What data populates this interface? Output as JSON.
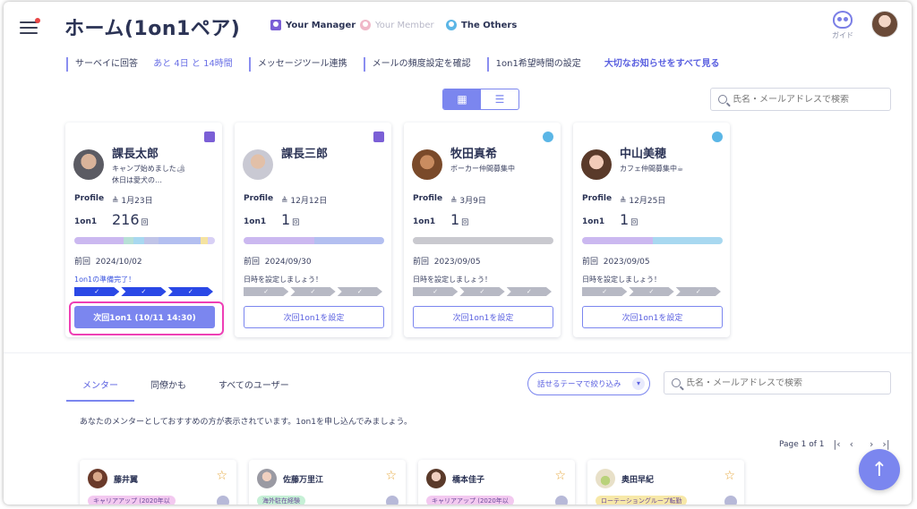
{
  "header": {
    "title": "ホーム(1on1ペア)",
    "legend": [
      {
        "label": "Your Manager",
        "icon": "manager-person-icon",
        "color": "#7b5fd6"
      },
      {
        "label": "Your Member",
        "icon": "member-person-icon",
        "color": "#f0b8c8"
      },
      {
        "label": "The Others",
        "icon": "others-person-icon",
        "color": "#5bb6e6"
      }
    ],
    "guide_label": "ガイド"
  },
  "linkbar": {
    "survey": "サーベイに回答",
    "survey_deadline": "あと 4日 と 14時間",
    "message_tool": "メッセージツール連携",
    "mail_frequency": "メールの頻度設定を確認",
    "preferred_time": "1on1希望時間の設定",
    "all_notices": "大切なお知らせをすべて見る"
  },
  "view_toggle": {
    "grid_icon": "grid-icon",
    "list_icon": "list-icon"
  },
  "search_top": {
    "placeholder": "氏名・メールアドレスで検索"
  },
  "pairs": [
    {
      "name": "課長太郎",
      "role": "manager",
      "status_line1": "キャンプ始めました🏕",
      "status_line2": "休日は愛犬の…",
      "profile_label": "Profile",
      "birthday": "1月23日",
      "oneonone_label": "1on1",
      "count": "216",
      "count_unit": "回",
      "bar": [
        {
          "color": "#cbb8f0",
          "w": 0.35
        },
        {
          "color": "#b7e0d6",
          "w": 0.07
        },
        {
          "color": "#a8d8f0",
          "w": 0.08
        },
        {
          "color": "#c0c4e8",
          "w": 0.1
        },
        {
          "color": "#b3bff0",
          "w": 0.3
        },
        {
          "color": "#f5e3a0",
          "w": 0.05
        },
        {
          "color": "#d8d0f5",
          "w": 0.05
        }
      ],
      "prev_label": "前回",
      "prev_date": "2024/10/02",
      "hint": "1on1の準備完了！",
      "steps_state": "done",
      "button": "次回1on1 (10/11 14:30)",
      "button_style": "primary"
    },
    {
      "name": "課長三郎",
      "role": "manager",
      "status_line1": "",
      "status_line2": "",
      "profile_label": "Profile",
      "birthday": "12月12日",
      "oneonone_label": "1on1",
      "count": "1",
      "count_unit": "回",
      "bar": [
        {
          "color": "#cbb8f0",
          "w": 0.5
        },
        {
          "color": "#b3bff0",
          "w": 0.5
        }
      ],
      "prev_label": "前回",
      "prev_date": "2024/09/30",
      "hint": "日時を設定しましょう！",
      "steps_state": "todo",
      "button": "次回1on1を設定",
      "button_style": "outline"
    },
    {
      "name": "牧田真希",
      "role": "others",
      "status_line1": "ボーカー仲間募集中",
      "status_line2": "",
      "profile_label": "Profile",
      "birthday": "3月9日",
      "oneonone_label": "1on1",
      "count": "1",
      "count_unit": "回",
      "bar": [
        {
          "color": "#c9c9cf",
          "w": 1.0
        }
      ],
      "prev_label": "前回",
      "prev_date": "2023/09/05",
      "hint": "日時を設定しましょう！",
      "steps_state": "todo",
      "button": "次回1on1を設定",
      "button_style": "outline"
    },
    {
      "name": "中山美穂",
      "role": "others",
      "status_line1": "カフェ仲間募集中☕",
      "status_line2": "",
      "profile_label": "Profile",
      "birthday": "12月25日",
      "oneonone_label": "1on1",
      "count": "1",
      "count_unit": "回",
      "bar": [
        {
          "color": "#cbb8f0",
          "w": 0.5
        },
        {
          "color": "#a8d8f0",
          "w": 0.5
        }
      ],
      "prev_label": "前回",
      "prev_date": "2023/09/05",
      "hint": "日時を設定しましょう！",
      "steps_state": "todo",
      "button": "次回1on1を設定",
      "button_style": "outline"
    }
  ],
  "mentor_section": {
    "tabs": [
      "メンター",
      "同僚かも",
      "すべてのユーザー"
    ],
    "active_tab": 0,
    "theme_filter": "話せるテーマで絞り込み",
    "search_placeholder": "氏名・メールアドレスで検索",
    "intro": "あなたのメンターとしておすすめの方が表示されています。1on1を申し込んでみましょう。",
    "pager_text": "Page 1 of 1",
    "mentors": [
      {
        "name": "藤井翼",
        "tag": "キャリアアップ (2020年以",
        "tag_color": "#f3c9f0"
      },
      {
        "name": "佐藤万里江",
        "tag": "海外駐在経験",
        "tag_color": "#c6f0d6"
      },
      {
        "name": "橋本佳子",
        "tag": "キャリアアップ (2020年以",
        "tag_color": "#f3c9f0"
      },
      {
        "name": "奥田早紀",
        "tag": "ローテーショングループ転勤",
        "tag_color": "#f7e8a8"
      }
    ]
  }
}
